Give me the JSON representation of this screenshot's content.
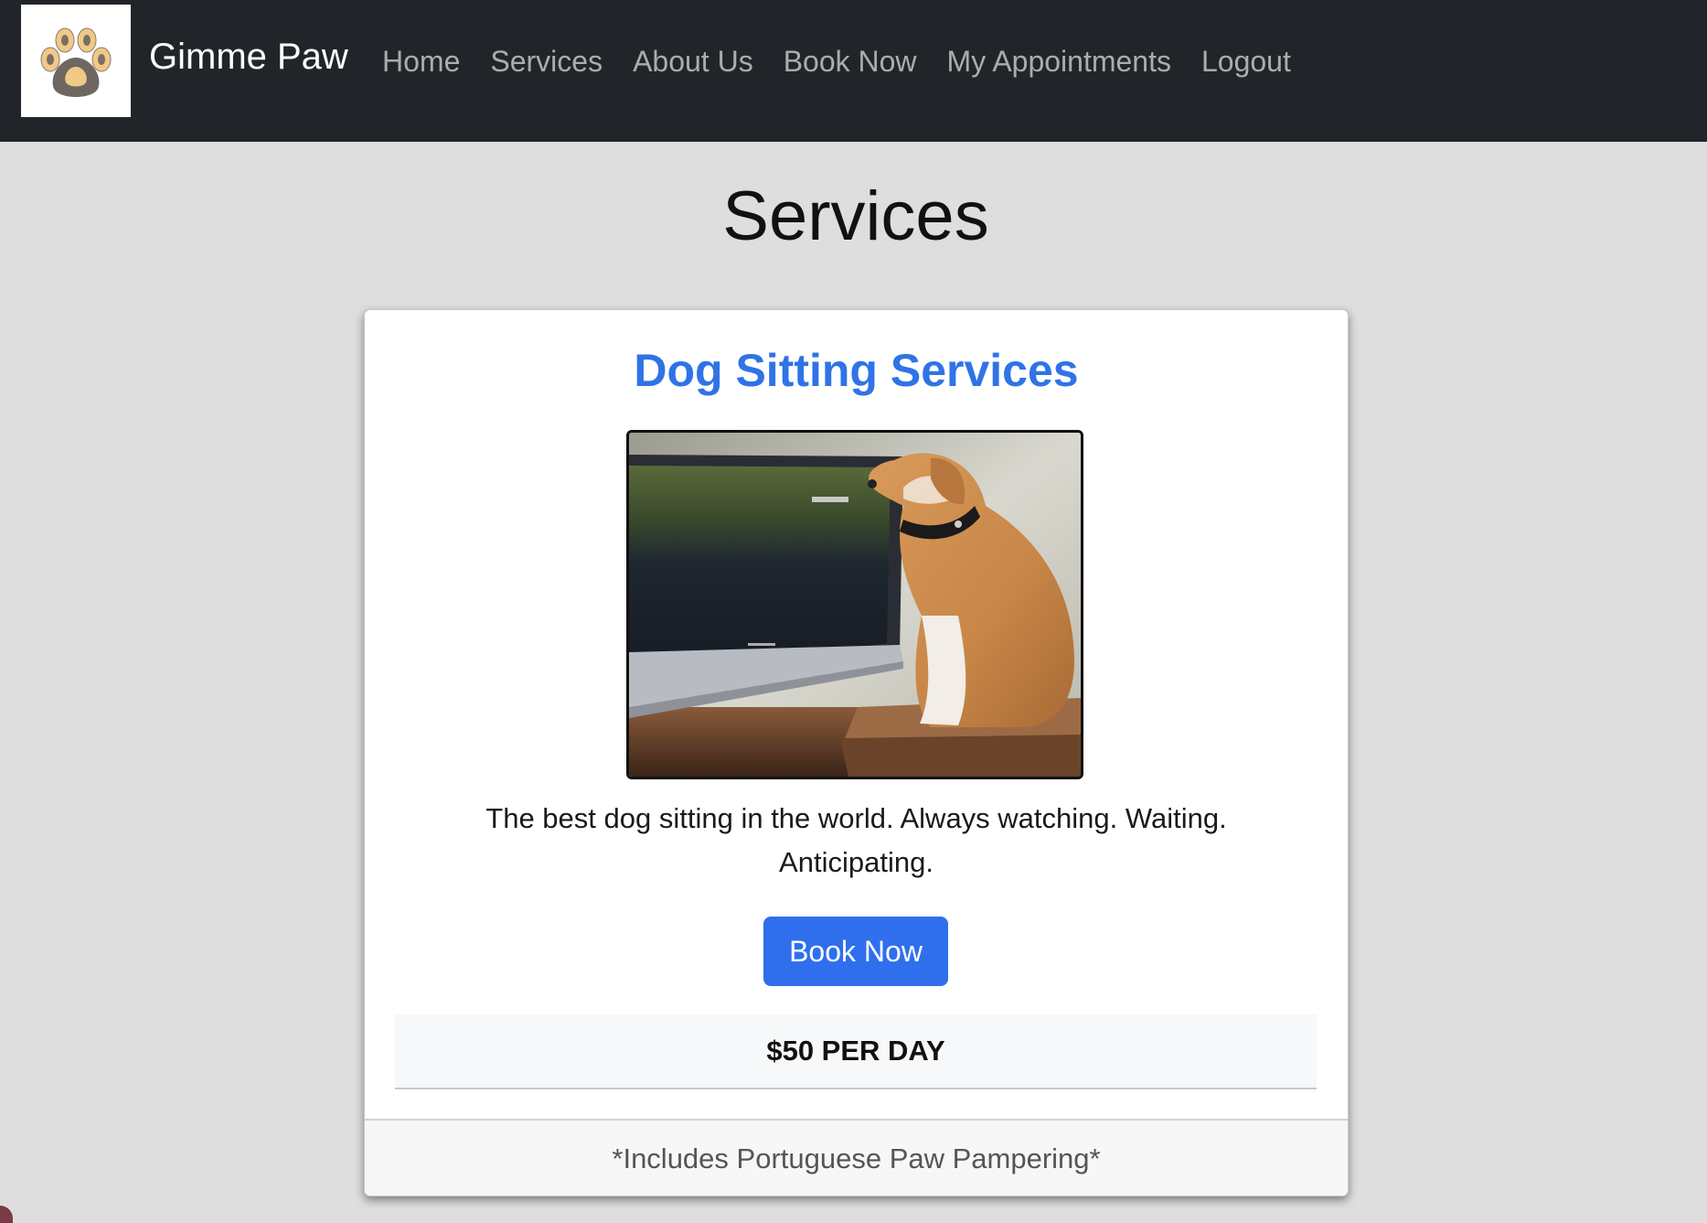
{
  "brand": {
    "name": "Gimme Paw",
    "logo_icon": "paw-icon"
  },
  "nav": {
    "items": [
      {
        "label": "Home"
      },
      {
        "label": "Services"
      },
      {
        "label": "About Us"
      },
      {
        "label": "Book Now"
      },
      {
        "label": "My Appointments"
      },
      {
        "label": "Logout"
      }
    ]
  },
  "page": {
    "title": "Services"
  },
  "service_card": {
    "title": "Dog Sitting Services",
    "image": "dog-watching-tv-photo",
    "description": "The best dog sitting in the world. Always watching. Waiting. Anticipating.",
    "book_label": "Book Now",
    "price": "$50 PER DAY",
    "footer_note": "*Includes Portuguese Paw Pampering*"
  },
  "colors": {
    "navbar_bg": "#212529",
    "accent": "#2f6fee",
    "title_blue": "#2f73e6",
    "page_bg": "#dedede"
  }
}
